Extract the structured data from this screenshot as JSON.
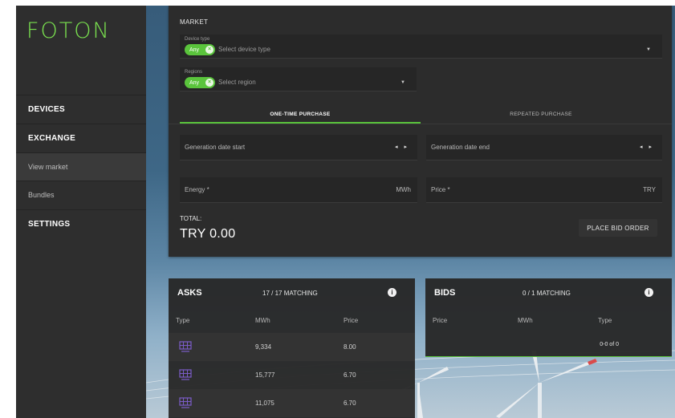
{
  "sidebar": {
    "logo": "FOTON",
    "items": [
      {
        "label": "DEVICES"
      },
      {
        "label": "EXCHANGE"
      },
      {
        "label": "View market"
      },
      {
        "label": "Bundles"
      },
      {
        "label": "SETTINGS"
      }
    ]
  },
  "market": {
    "title": "MARKET",
    "device_type": {
      "label": "Device type",
      "chip": "Any",
      "placeholder": "Select device type"
    },
    "regions": {
      "label": "Regions",
      "chip": "Any",
      "placeholder": "Select region"
    },
    "tabs": [
      {
        "label": "ONE-TIME PURCHASE",
        "active": true
      },
      {
        "label": "REPEATED PURCHASE",
        "active": false
      }
    ],
    "generation_start": {
      "label": "Generation date start"
    },
    "generation_end": {
      "label": "Generation date end"
    },
    "energy": {
      "label": "Energy *",
      "unit": "MWh"
    },
    "price": {
      "label": "Price *",
      "unit": "TRY"
    },
    "total_label": "TOTAL:",
    "total_value": "TRY 0.00",
    "place_bid_label": "PLACE BID ORDER"
  },
  "asks": {
    "title": "ASKS",
    "matching": "17 / 17 MATCHING",
    "columns": [
      "Type",
      "MWh",
      "Price"
    ],
    "rows": [
      {
        "type_icon": "solar-panel-icon",
        "mwh": "9,334",
        "price": "8.00"
      },
      {
        "type_icon": "solar-panel-icon",
        "mwh": "15,777",
        "price": "6.70"
      },
      {
        "type_icon": "solar-panel-icon",
        "mwh": "11,075",
        "price": "6.70"
      }
    ]
  },
  "bids": {
    "title": "BIDS",
    "matching": "0 / 1 MATCHING",
    "columns": [
      "Price",
      "MWh",
      "Type"
    ],
    "pager": "0-0 of 0"
  },
  "colors": {
    "accent": "#5ac43c",
    "panel": "#2c2c2c",
    "sidebar": "#2e2e2e"
  }
}
